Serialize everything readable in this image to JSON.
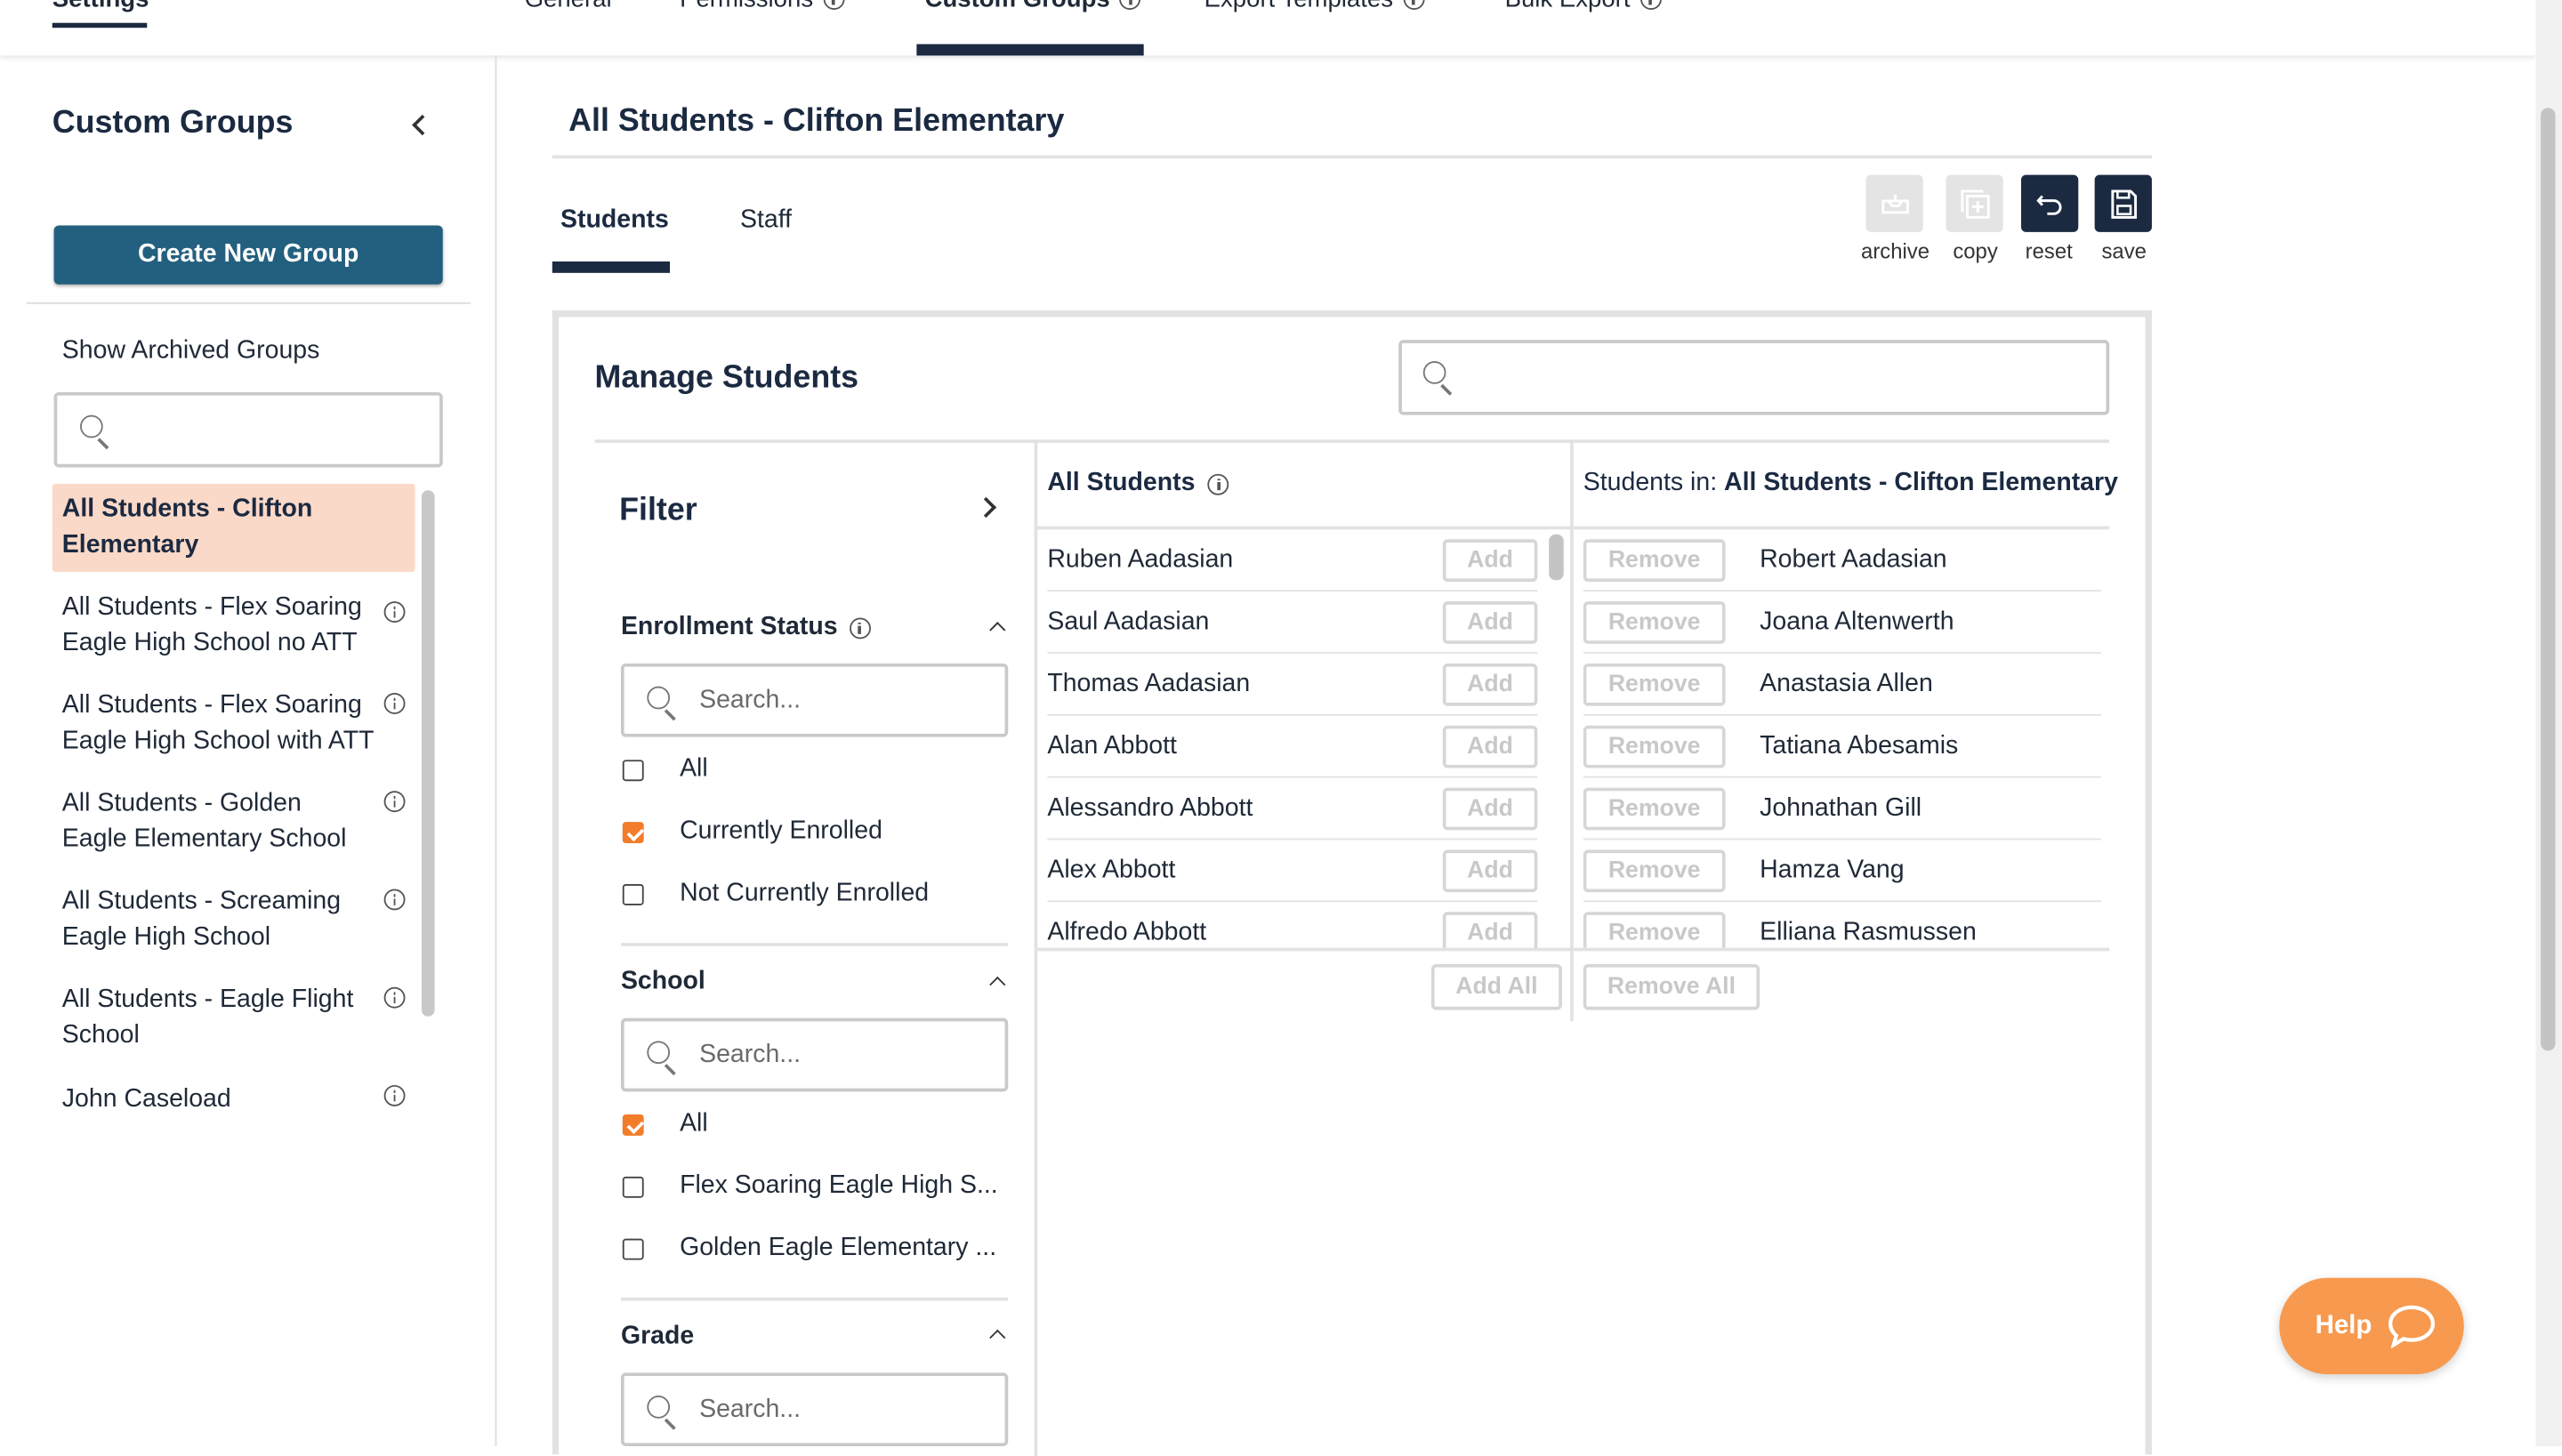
{
  "topnav": {
    "settings": "Settings",
    "general": "General",
    "permissions": "Permissions",
    "custom_groups": "Custom Groups",
    "export_templates": "Export Templates",
    "bulk_export": "Bulk Export"
  },
  "sidebar": {
    "title": "Custom Groups",
    "create_button": "Create New Group",
    "show_archived": "Show Archived Groups",
    "groups": [
      {
        "label": "All Students - Clifton Elementary",
        "selected": true
      },
      {
        "label": "All Students - Flex Soaring Eagle High School no ATT"
      },
      {
        "label": "All Students - Flex Soaring Eagle High School with ATT"
      },
      {
        "label": "All Students - Golden Eagle Elementary School"
      },
      {
        "label": "All Students - Screaming Eagle High School"
      },
      {
        "label": "All Students - Eagle Flight School"
      },
      {
        "label": "John Caseload"
      }
    ]
  },
  "main": {
    "title": "All Students - Clifton Elementary",
    "tabs": [
      "Students",
      "Staff"
    ],
    "actions": {
      "archive": "archive",
      "copy": "copy",
      "reset": "reset",
      "save": "save"
    },
    "manage_title": "Manage Students"
  },
  "filter": {
    "title": "Filter",
    "search_placeholder": "Search...",
    "enrollment": {
      "title": "Enrollment Status",
      "options": [
        {
          "label": "All",
          "checked": false
        },
        {
          "label": "Currently Enrolled",
          "checked": true
        },
        {
          "label": "Not Currently Enrolled",
          "checked": false
        }
      ]
    },
    "school": {
      "title": "School",
      "options": [
        {
          "label": "All",
          "checked": true
        },
        {
          "label": "Flex Soaring Eagle High S...",
          "checked": false
        },
        {
          "label": "Golden Eagle Elementary ...",
          "checked": false
        }
      ]
    },
    "grade": {
      "title": "Grade"
    }
  },
  "all_students": {
    "header": "All Students",
    "add_label": "Add",
    "add_all": "Add All",
    "rows": [
      "Ruben Aadasian",
      "Saul Aadasian",
      "Thomas Aadasian",
      "Alan Abbott",
      "Alessandro Abbott",
      "Alex Abbott",
      "Alfredo Abbott"
    ]
  },
  "group_students": {
    "header_prefix": "Students in: ",
    "header_group": "All Students - Clifton Elementary",
    "remove_label": "Remove",
    "remove_all": "Remove All",
    "rows": [
      "Robert Aadasian",
      "Joana Altenwerth",
      "Anastasia Allen",
      "Tatiana Abesamis",
      "Johnathan Gill",
      "Hamza Vang",
      "Elliana Rasmussen"
    ]
  },
  "help": {
    "label": "Help"
  },
  "colors": {
    "navy": "#1b2a41",
    "button_blue": "#23607f",
    "selected_bg": "#fbd9c8",
    "accent_orange": "#f27c2a",
    "help_orange": "#f79a4f"
  }
}
